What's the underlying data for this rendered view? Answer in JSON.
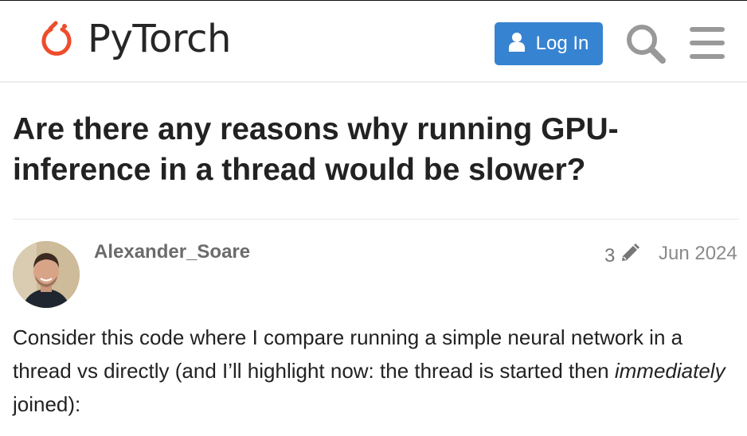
{
  "header": {
    "brand": "PyTorch",
    "login_label": "Log In",
    "brand_color": "#ee4c2c",
    "accent_color": "#3683d1",
    "icons": [
      "pytorch-logo-icon",
      "user-icon",
      "search-icon",
      "hamburger-menu-icon"
    ]
  },
  "topic": {
    "title": "Are there any reasons why running GPU-inference in a thread would be slower?"
  },
  "post": {
    "author": "Alexander_Soare",
    "edit_count": "3",
    "date": "Jun 2024",
    "body_part1": "Consider this code where I compare running a simple neural network in a thread vs directly (and I’ll highlight now: the thread is started then ",
    "body_emphasis": "immediately",
    "body_part2": " joined):"
  }
}
